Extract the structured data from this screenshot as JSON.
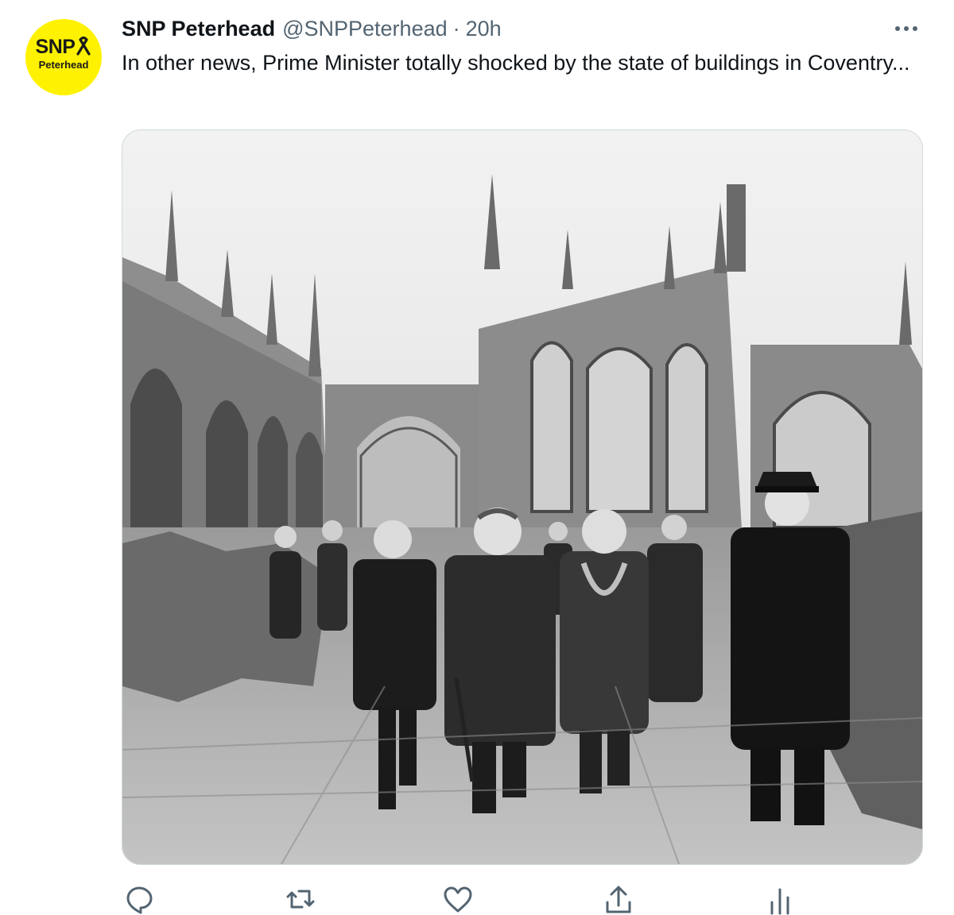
{
  "tweet": {
    "avatar": {
      "logo_text": "SNP",
      "logo_subtext": "Peterhead",
      "background_color": "#fff200"
    },
    "author": {
      "display_name": "SNP Peterhead",
      "handle": "@SNPPeterhead"
    },
    "separator": "·",
    "timestamp": "20h",
    "text": "In other news, Prime Minister totally shocked by the state of buildings in Coventry...",
    "media": {
      "kind": "black-and-white photograph",
      "icon": "photo"
    },
    "menu_icon": "more-horizontal-icon",
    "actions": [
      {
        "name": "reply",
        "icon": "reply-icon"
      },
      {
        "name": "retweet",
        "icon": "retweet-icon"
      },
      {
        "name": "like",
        "icon": "heart-icon"
      },
      {
        "name": "share",
        "icon": "share-icon"
      },
      {
        "name": "analytics",
        "icon": "analytics-icon"
      }
    ],
    "colors": {
      "text_primary": "#0f1419",
      "text_secondary": "#536471",
      "border": "#cfd9de"
    }
  }
}
